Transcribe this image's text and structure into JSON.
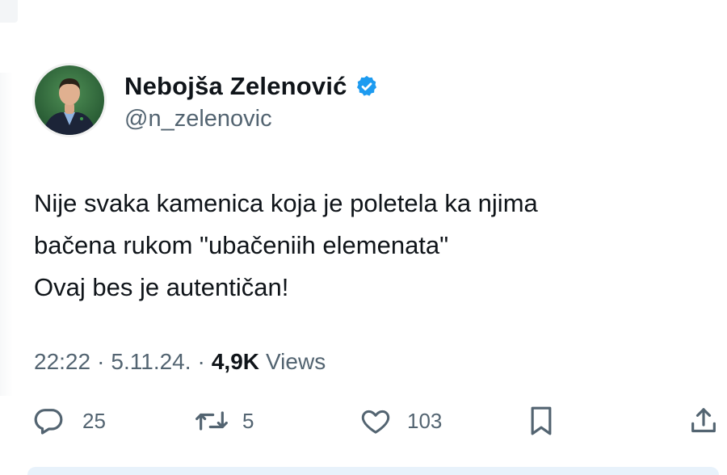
{
  "author": {
    "display_name": "Nebojša Zelenović",
    "handle": "@n_zelenovic",
    "verified_icon": "verified-badge-icon",
    "badge_color": "#1d9bf0"
  },
  "tweet": {
    "lines": [
      "Nije svaka kamenica koja je poletela ka njima",
      "bačena rukom \"ubačeniih elemenata\"",
      "Ovaj bes je autentičan!"
    ]
  },
  "meta": {
    "time": "22:22",
    "sep1": "·",
    "date": "5.11.24.",
    "sep2": "·",
    "views_count": "4,9K",
    "views_label": "Views"
  },
  "actions": {
    "reply": {
      "icon": "reply-icon",
      "count": "25"
    },
    "retweet": {
      "icon": "retweet-icon",
      "count": "5"
    },
    "like": {
      "icon": "heart-icon",
      "count": "103"
    },
    "bookmark": {
      "icon": "bookmark-icon"
    },
    "share": {
      "icon": "share-icon"
    }
  },
  "colors": {
    "text": "#0f1419",
    "secondary": "#536471",
    "avatar_bg": "#2f6b3f"
  }
}
